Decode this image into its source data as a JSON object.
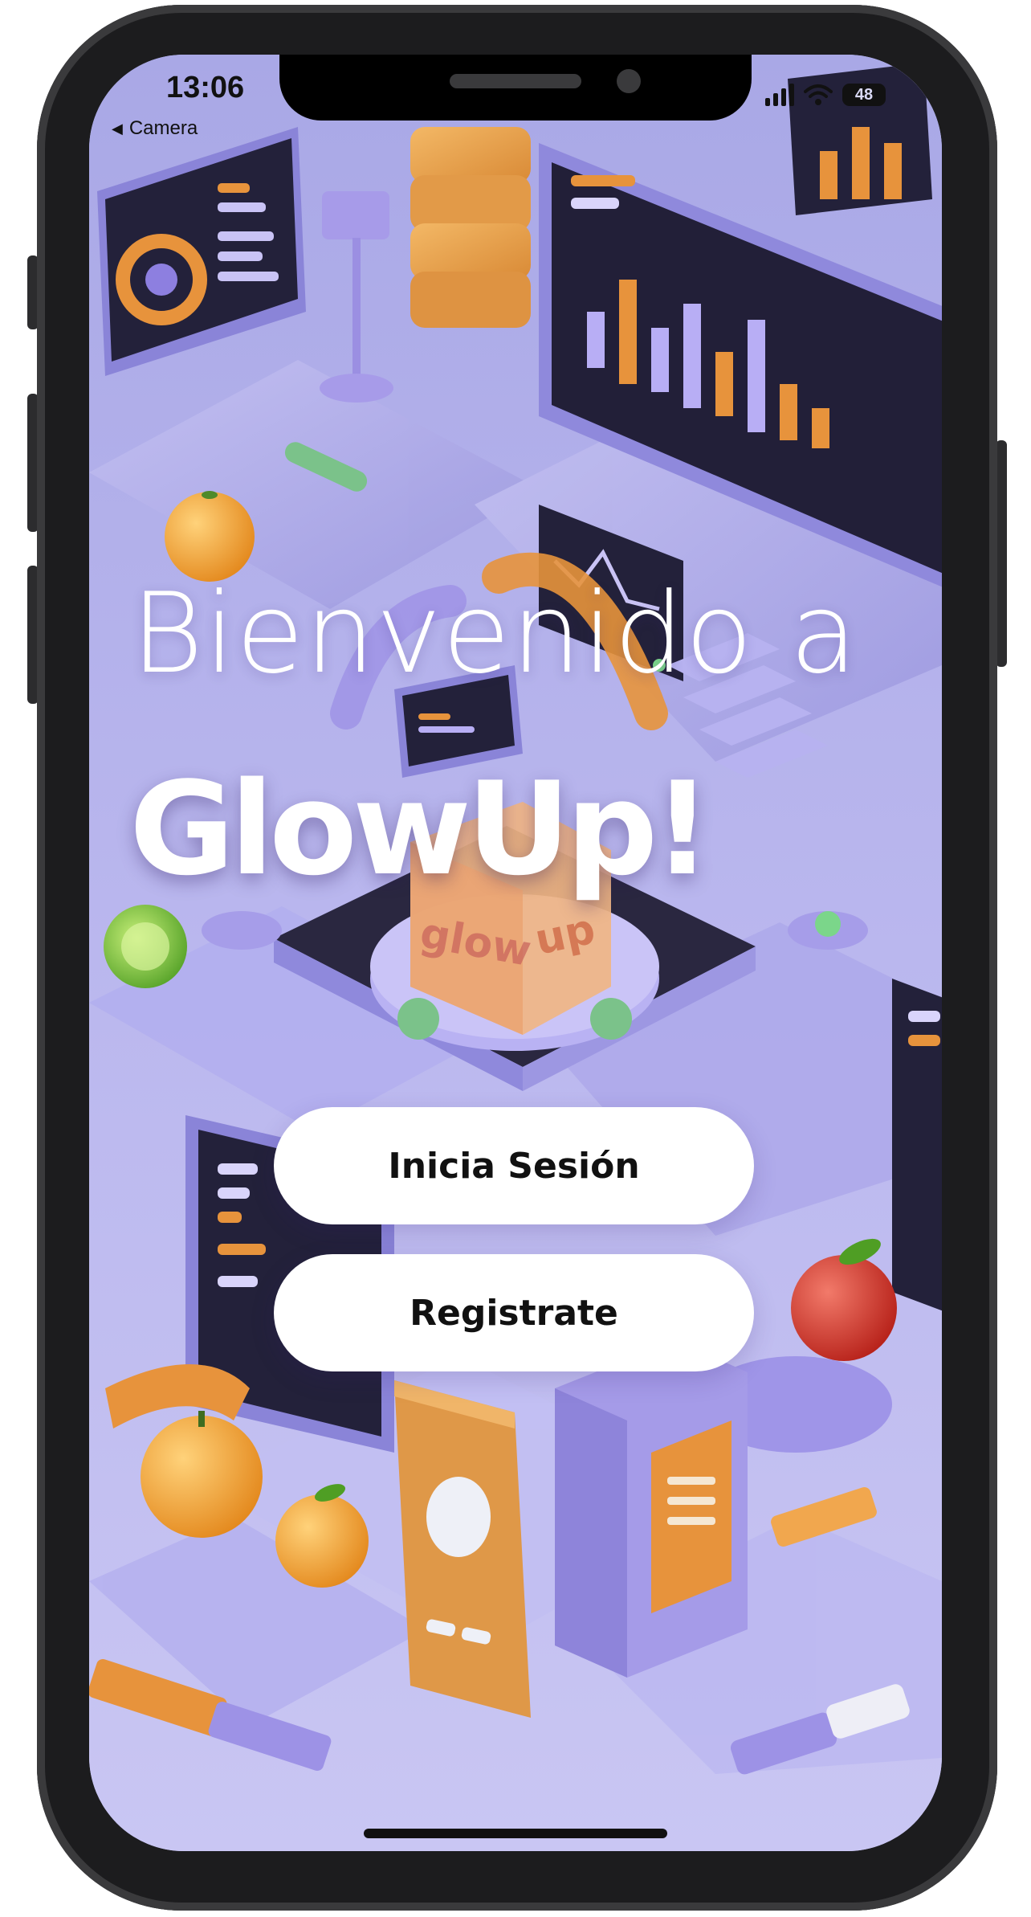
{
  "status_bar": {
    "time": "13:06",
    "back_label": "Camera",
    "battery": "48"
  },
  "welcome": {
    "line1": "Bienvenido a",
    "line2": "GlowUp!",
    "box_word_1": "glow",
    "box_word_2": "up"
  },
  "actions": {
    "login_label": "Inicia Sesión",
    "register_label": "Registrate"
  },
  "colors": {
    "background_lavender": "#b8b8ec",
    "accent_orange": "#e9a04a",
    "accent_purple": "#8d7fe0",
    "button_bg": "#ffffff",
    "button_text": "#111111"
  },
  "icons": [
    "back-arrow-icon",
    "signal-icon",
    "wifi-icon",
    "battery-icon"
  ]
}
